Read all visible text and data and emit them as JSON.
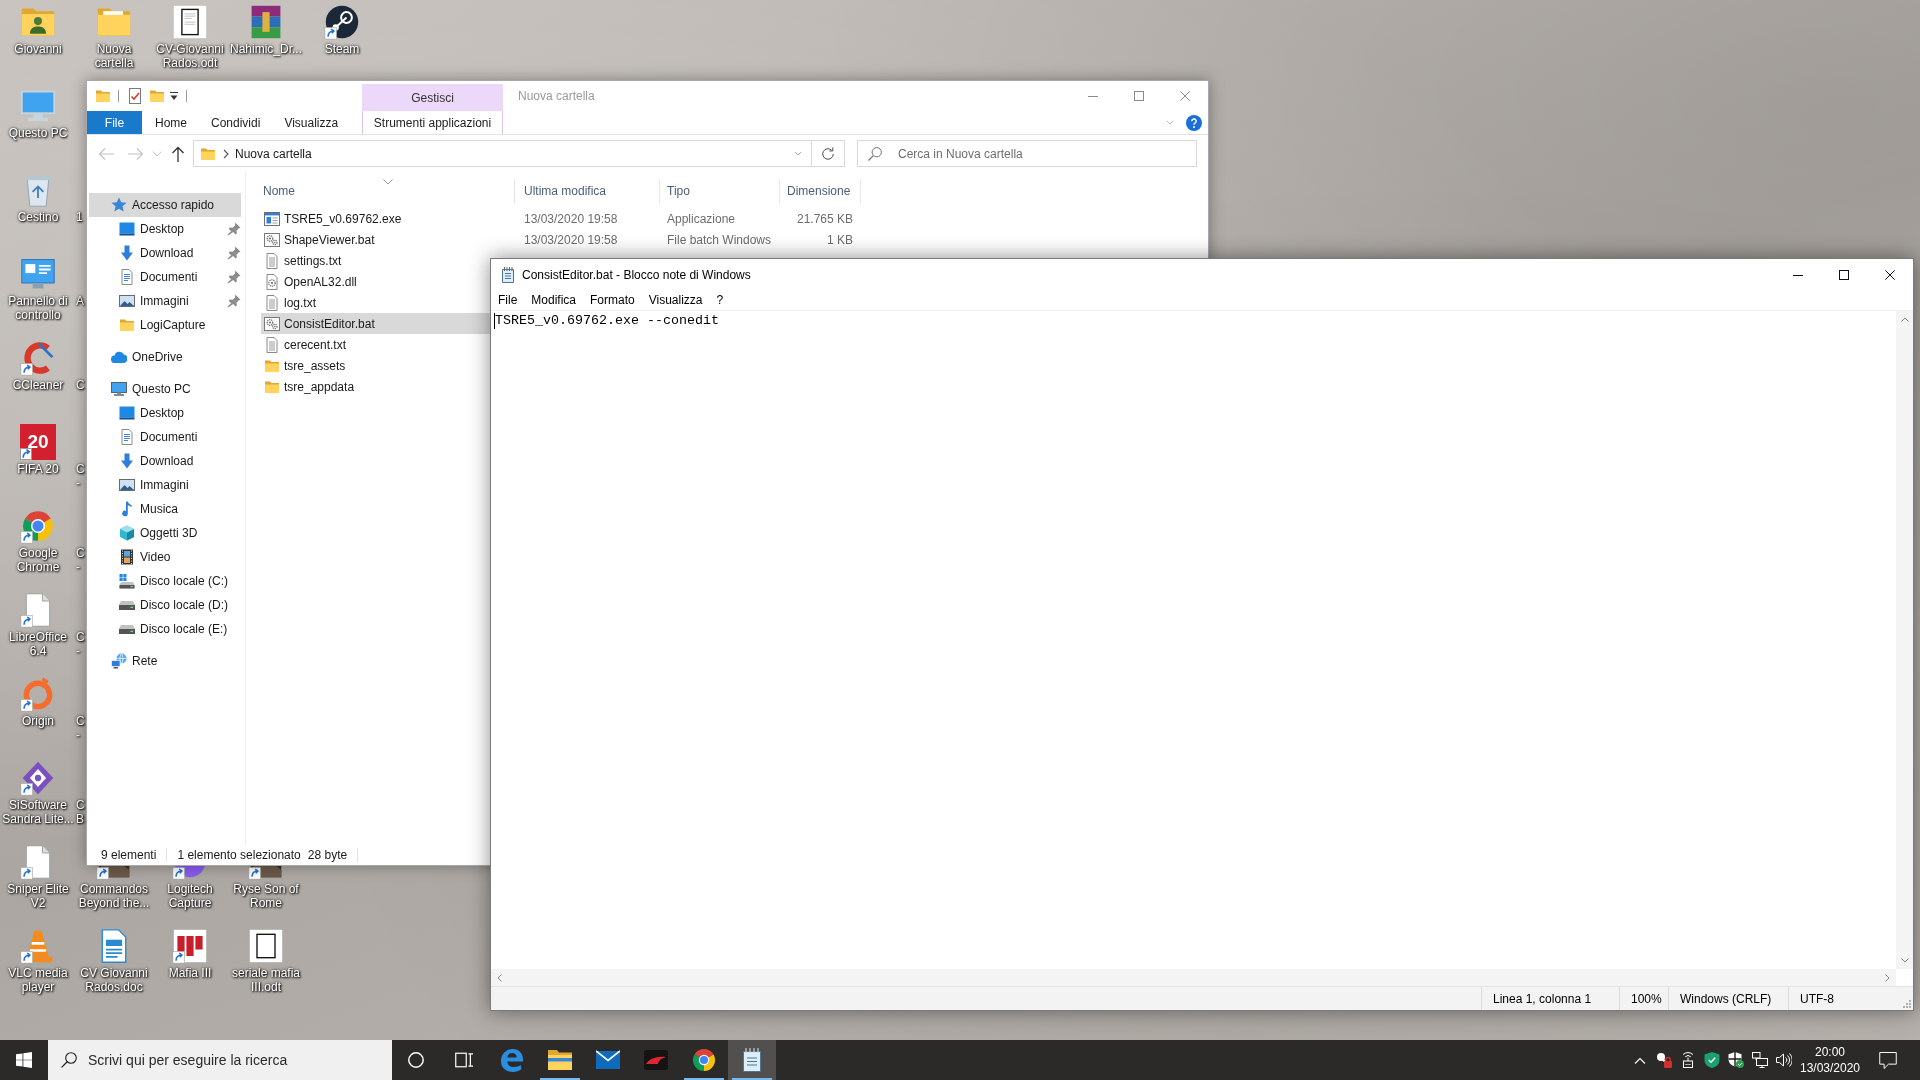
{
  "desktop": {
    "left_column": [
      {
        "label": "Giovanni",
        "kind": "user-folder",
        "shortcut": false
      },
      {
        "label": "Questo PC",
        "kind": "computer",
        "shortcut": false
      },
      {
        "label": "Cestino",
        "kind": "recycle-bin",
        "shortcut": false
      },
      {
        "label": "Pannello di controllo",
        "kind": "control-panel",
        "shortcut": false
      },
      {
        "label": "CCleaner",
        "kind": "ccleaner",
        "shortcut": true
      },
      {
        "label": "FIFA 20",
        "kind": "number-tile",
        "icon_text": "20",
        "shortcut": true
      },
      {
        "label": "Google Chrome",
        "kind": "chrome",
        "shortcut": true
      },
      {
        "label": "LibreOffice 6.4",
        "kind": "document",
        "shortcut": true
      },
      {
        "label": "Origin",
        "kind": "origin",
        "shortcut": true
      },
      {
        "label": "SiSoftware Sandra Lite...",
        "kind": "sandra",
        "shortcut": true
      },
      {
        "label": "Sniper Elite V2",
        "kind": "document",
        "shortcut": true
      },
      {
        "label": "VLC media player",
        "kind": "vlc",
        "shortcut": true
      }
    ],
    "top_row": [
      {
        "label": "Nuova cartella",
        "kind": "folder",
        "shortcut": false
      },
      {
        "label": "CV-Giovanni Rados.odt",
        "kind": "odt",
        "shortcut": false
      },
      {
        "label": "Nahimic_Dr...",
        "kind": "archive",
        "shortcut": false
      },
      {
        "label": "Steam",
        "kind": "steam",
        "shortcut": true
      }
    ],
    "covered_labels": [
      {
        "lines": [
          "1"
        ]
      },
      {
        "lines": [
          "A"
        ]
      },
      {
        "lines": [
          "C"
        ]
      },
      {
        "lines": [
          "C",
          "-"
        ]
      },
      {
        "lines": [
          "C",
          "-"
        ]
      },
      {
        "lines": [
          "C",
          "-"
        ]
      },
      {
        "lines": [
          "C",
          "-"
        ]
      },
      {
        "lines": [
          "C",
          "B"
        ]
      }
    ],
    "bottom_rows": [
      [
        {
          "label": "Commandos Beyond the...",
          "kind": "game",
          "shortcut": true
        },
        {
          "label": "Logitech Capture",
          "kind": "logitech",
          "shortcut": true
        },
        {
          "label": "Ryse Son of Rome",
          "kind": "game",
          "shortcut": true
        }
      ],
      [
        {
          "label": "CV Giovanni Rados.doc",
          "kind": "writer-doc",
          "shortcut": false
        },
        {
          "label": "Mafia III",
          "kind": "mafia",
          "shortcut": true
        },
        {
          "label": "seriale mafia III.odt",
          "kind": "blank-doc",
          "shortcut": false
        }
      ]
    ]
  },
  "explorer": {
    "context_group": "Gestisci",
    "title": "Nuova cartella",
    "ribbon_tabs": [
      {
        "label": "File",
        "kind": "file"
      },
      {
        "label": "Home",
        "kind": "tab"
      },
      {
        "label": "Condividi",
        "kind": "tab"
      },
      {
        "label": "Visualizza",
        "kind": "tab"
      },
      {
        "label": "Strumenti applicazioni",
        "kind": "contextual"
      }
    ],
    "nav_buttons": [
      {
        "kind": "back",
        "disabled": true
      },
      {
        "kind": "forward",
        "disabled": true
      },
      {
        "kind": "recent",
        "disabled": true
      },
      {
        "kind": "up",
        "disabled": false
      }
    ],
    "address": {
      "path": "Nuova cartella"
    },
    "search": {
      "placeholder": "Cerca in Nuova cartella"
    },
    "nav": [
      {
        "label": "Accesso rapido",
        "kind": "star",
        "selected": true,
        "children": [
          {
            "label": "Desktop",
            "kind": "desktop",
            "pinned": true,
            "selected": false
          },
          {
            "label": "Download",
            "kind": "download",
            "pinned": true,
            "selected": false
          },
          {
            "label": "Documenti",
            "kind": "documents",
            "pinned": true,
            "selected": false
          },
          {
            "label": "Immagini",
            "kind": "pictures",
            "pinned": true,
            "selected": false
          },
          {
            "label": "LogiCapture",
            "kind": "folder",
            "pinned": false,
            "selected": false
          }
        ]
      },
      {
        "label": "OneDrive",
        "kind": "cloud",
        "selected": false
      },
      {
        "label": "Questo PC",
        "kind": "computer",
        "selected": false,
        "children": [
          {
            "label": "Desktop",
            "kind": "desktop",
            "pinned": false,
            "selected": false
          },
          {
            "label": "Documenti",
            "kind": "documents",
            "pinned": false,
            "selected": false
          },
          {
            "label": "Download",
            "kind": "download",
            "pinned": false,
            "selected": false
          },
          {
            "label": "Immagini",
            "kind": "pictures",
            "pinned": false,
            "selected": false
          },
          {
            "label": "Musica",
            "kind": "music",
            "pinned": false,
            "selected": false
          },
          {
            "label": "Oggetti 3D",
            "kind": "cube",
            "pinned": false,
            "selected": false
          },
          {
            "label": "Video",
            "kind": "video",
            "pinned": false,
            "selected": false
          },
          {
            "label": "Disco locale (C:)",
            "kind": "drive-system",
            "pinned": false,
            "selected": false
          },
          {
            "label": "Disco locale (D:)",
            "kind": "drive",
            "pinned": false,
            "selected": false
          },
          {
            "label": "Disco locale (E:)",
            "kind": "drive",
            "pinned": false,
            "selected": false
          }
        ]
      },
      {
        "label": "Rete",
        "kind": "network",
        "selected": false
      }
    ],
    "columns": [
      {
        "label": "Nome",
        "sorted": true
      },
      {
        "label": "Ultima modifica",
        "sorted": false
      },
      {
        "label": "Tipo",
        "sorted": false
      },
      {
        "label": "Dimensione",
        "sorted": false
      }
    ],
    "files": [
      {
        "name": "TSRE5_v0.69762.exe",
        "kind": "exe",
        "modified": "13/03/2020 19:58",
        "type": "Applicazione",
        "size": "21.765 KB",
        "selected": false
      },
      {
        "name": "ShapeViewer.bat",
        "kind": "bat",
        "modified": "13/03/2020 19:58",
        "type": "File batch Windows",
        "size": "1 KB",
        "selected": false
      },
      {
        "name": "settings.txt",
        "kind": "txt",
        "selected": false
      },
      {
        "name": "OpenAL32.dll",
        "kind": "dll",
        "selected": false
      },
      {
        "name": "log.txt",
        "kind": "txt",
        "selected": false
      },
      {
        "name": "ConsistEditor.bat",
        "kind": "bat",
        "selected": true
      },
      {
        "name": "cerecent.txt",
        "kind": "txt",
        "selected": false
      },
      {
        "name": "tsre_assets",
        "kind": "folder",
        "selected": false
      },
      {
        "name": "tsre_appdata",
        "kind": "folder",
        "selected": false
      }
    ],
    "status": {
      "items": "9 elementi",
      "selection": "1 elemento selezionato",
      "size": "28 byte"
    }
  },
  "notepad": {
    "title": "ConsistEditor.bat - Blocco note di Windows",
    "menu": [
      "File",
      "Modifica",
      "Formato",
      "Visualizza",
      "?"
    ],
    "text": "TSRE5_v0.69762.exe --conedit",
    "status": [
      "Linea 1, colonna 1",
      "100%",
      "Windows (CRLF)",
      "UTF-8"
    ]
  },
  "taskbar": {
    "search": {
      "placeholder": "Scrivi qui per eseguire la ricerca"
    },
    "apps": [
      {
        "kind": "edge",
        "running": false,
        "selected": false
      },
      {
        "kind": "explorer",
        "running": true,
        "selected": false
      },
      {
        "kind": "mail",
        "running": false,
        "selected": false
      },
      {
        "kind": "game",
        "running": false,
        "selected": false
      },
      {
        "kind": "chrome",
        "running": true,
        "selected": false
      },
      {
        "kind": "notepad",
        "running": true,
        "selected": true
      }
    ],
    "time": "20:00",
    "date": "13/03/2020"
  }
}
